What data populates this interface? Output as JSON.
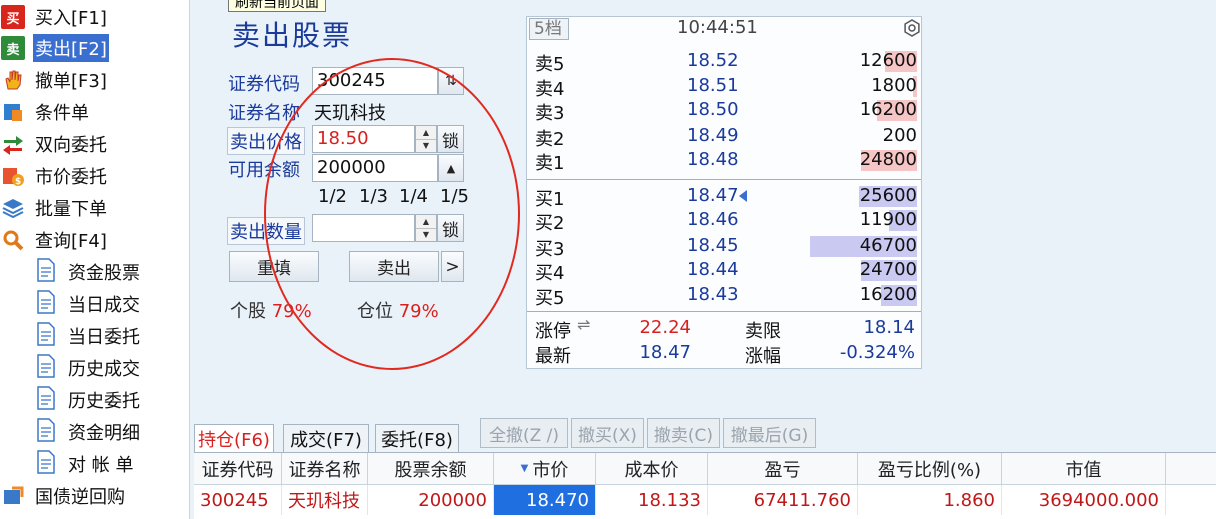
{
  "tooltip": "刷新当前页面",
  "sidebar": {
    "items": [
      {
        "label": "买入[F1]",
        "icon": "buy-icon",
        "glyph": "买"
      },
      {
        "label": "卖出[F2]",
        "icon": "sell-icon",
        "glyph": "卖"
      },
      {
        "label": "撤单[F3]",
        "icon": "hand-icon",
        "glyph": ""
      },
      {
        "label": "条件单",
        "icon": "conditional-order-icon",
        "glyph": ""
      },
      {
        "label": "双向委托",
        "icon": "two-way-icon",
        "glyph": ""
      },
      {
        "label": "市价委托",
        "icon": "market-order-icon",
        "glyph": ""
      },
      {
        "label": "批量下单",
        "icon": "batch-order-icon",
        "glyph": ""
      },
      {
        "label": "查询[F4]",
        "icon": "search-icon",
        "glyph": ""
      }
    ],
    "sub_items": [
      "资金股票",
      "当日成交",
      "当日委托",
      "历史成交",
      "历史委托",
      "资金明细",
      "对 帐 单"
    ],
    "bottom_item": "国债逆回购"
  },
  "form": {
    "title": "卖出股票",
    "code_label": "证券代码",
    "code_value": "300245",
    "name_label": "证券名称",
    "name_value": "天玑科技",
    "price_label": "卖出价格",
    "price_value": "18.50",
    "lock_label": "锁",
    "avail_label": "可用余额",
    "avail_value": "200000",
    "fractions": [
      "1/2",
      "1/3",
      "1/4",
      "1/5"
    ],
    "qty_label": "卖出数量",
    "qty_value": "",
    "reset_label": "重填",
    "sell_label": "卖出",
    "more_label": ">",
    "stock_pos_label": "个股",
    "stock_pos_value": "79%",
    "position_label": "仓位",
    "position_value": "79%"
  },
  "book": {
    "tab": "5档",
    "time": "10:44:51",
    "asks": [
      {
        "label": "卖5",
        "price": "18.52",
        "vol": "12600"
      },
      {
        "label": "卖4",
        "price": "18.51",
        "vol": "1800"
      },
      {
        "label": "卖3",
        "price": "18.50",
        "vol": "16200"
      },
      {
        "label": "卖2",
        "price": "18.49",
        "vol": "200"
      },
      {
        "label": "卖1",
        "price": "18.48",
        "vol": "24800"
      }
    ],
    "bids": [
      {
        "label": "买1",
        "price": "18.47",
        "vol": "25600"
      },
      {
        "label": "买2",
        "price": "18.46",
        "vol": "11900"
      },
      {
        "label": "买3",
        "price": "18.45",
        "vol": "46700"
      },
      {
        "label": "买4",
        "price": "18.44",
        "vol": "24700"
      },
      {
        "label": "买5",
        "price": "18.43",
        "vol": "16200"
      }
    ],
    "limit_up_label": "涨停",
    "limit_up_value": "22.24",
    "limit_down_label": "卖限",
    "limit_down_value": "18.14",
    "last_label": "最新",
    "last_value": "18.47",
    "change_label": "涨幅",
    "change_value": "-0.324%"
  },
  "bottom": {
    "tabs": [
      "持仓(F6)",
      "成交(F7)",
      "委托(F8)"
    ],
    "buttons": [
      "全撤(Z /)",
      "撤买(X)",
      "撤卖(C)",
      "撤最后(G)"
    ],
    "columns": [
      "证券代码",
      "证券名称",
      "股票余额",
      "市价",
      "成本价",
      "盈亏",
      "盈亏比例(%)",
      "市值"
    ],
    "row": [
      "300245",
      "天玑科技",
      "200000",
      "18.470",
      "18.133",
      "67411.760",
      "1.860",
      "3694000.000"
    ]
  }
}
